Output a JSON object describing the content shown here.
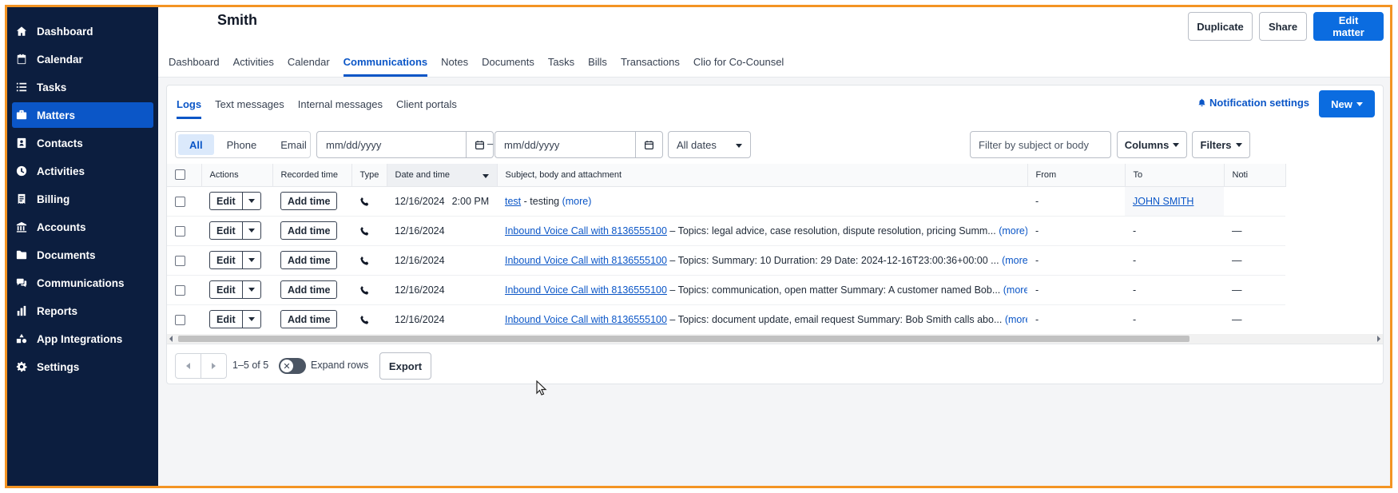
{
  "sidebar": {
    "items": [
      {
        "label": "Dashboard",
        "icon": "home-icon",
        "active": false
      },
      {
        "label": "Calendar",
        "icon": "calendar-icon",
        "active": false
      },
      {
        "label": "Tasks",
        "icon": "list-icon",
        "active": false
      },
      {
        "label": "Matters",
        "icon": "briefcase-icon",
        "active": true
      },
      {
        "label": "Contacts",
        "icon": "contact-card-icon",
        "active": false
      },
      {
        "label": "Activities",
        "icon": "clock-icon",
        "active": false
      },
      {
        "label": "Billing",
        "icon": "receipt-icon",
        "active": false
      },
      {
        "label": "Accounts",
        "icon": "bank-icon",
        "active": false
      },
      {
        "label": "Documents",
        "icon": "folder-icon",
        "active": false
      },
      {
        "label": "Communications",
        "icon": "chat-bubbles-icon",
        "active": false
      },
      {
        "label": "Reports",
        "icon": "bar-chart-icon",
        "active": false
      },
      {
        "label": "App Integrations",
        "icon": "shapes-icon",
        "active": false
      },
      {
        "label": "Settings",
        "icon": "gear-icon",
        "active": false
      }
    ]
  },
  "header": {
    "matter_title": "Smith",
    "duplicate_label": "Duplicate",
    "share_label": "Share",
    "edit_label": "Edit matter"
  },
  "tabs": [
    "Dashboard",
    "Activities",
    "Calendar",
    "Communications",
    "Notes",
    "Documents",
    "Tasks",
    "Bills",
    "Transactions",
    "Clio for Co-Counsel"
  ],
  "active_tab": "Communications",
  "subtabs": [
    "Logs",
    "Text messages",
    "Internal messages",
    "Client portals"
  ],
  "active_subtab": "Logs",
  "notification_label": "Notification settings",
  "new_label": "New",
  "filters": {
    "segments": [
      "All",
      "Phone",
      "Email"
    ],
    "active_segment": "All",
    "date_from_placeholder": "mm/dd/yyyy",
    "date_to_placeholder": "mm/dd/yyyy",
    "date_separator": "–",
    "date_range": "All dates",
    "search_placeholder": "Filter by subject or body",
    "columns_label": "Columns",
    "filters_label": "Filters"
  },
  "table": {
    "headers": [
      "Actions",
      "Recorded time",
      "Type",
      "Date and time",
      "Subject, body and attachment",
      "From",
      "To",
      "Noti"
    ],
    "edit_label": "Edit",
    "add_time_label": "Add time",
    "more_label": "(more)",
    "rows": [
      {
        "date": "12/16/2024",
        "time": "2:00 PM",
        "subject": "test",
        "body": " - testing",
        "from": "-",
        "to": "JOHN SMITH",
        "noti": ""
      },
      {
        "date": "12/16/2024",
        "time": "",
        "subject": "Inbound Voice Call with 8136555100",
        "body": " – Topics: legal advice, case resolution, dispute resolution, pricing Summ...",
        "from": "-",
        "to": "-",
        "noti": "—"
      },
      {
        "date": "12/16/2024",
        "time": "",
        "subject": "Inbound Voice Call with 8136555100",
        "body": " – Topics: Summary: 10 Durration: 29 Date: 2024-12-16T23:00:36+00:00 ...",
        "from": "-",
        "to": "-",
        "noti": "—"
      },
      {
        "date": "12/16/2024",
        "time": "",
        "subject": "Inbound Voice Call with 8136555100",
        "body": " – Topics: communication, open matter Summary: A customer named Bob...",
        "from": "-",
        "to": "-",
        "noti": "—"
      },
      {
        "date": "12/16/2024",
        "time": "",
        "subject": "Inbound Voice Call with 8136555100",
        "body": " – Topics: document update, email request Summary: Bob Smith calls abo...",
        "from": "-",
        "to": "-",
        "noti": "—"
      }
    ]
  },
  "footer": {
    "page_info": "1–5 of 5",
    "expand_label": "Expand rows",
    "export_label": "Export"
  },
  "colors": {
    "sidebar_bg": "#0c1e3f",
    "accent": "#0b56c7",
    "primary_button": "#0b6ce0",
    "frame_border": "#f39423"
  }
}
